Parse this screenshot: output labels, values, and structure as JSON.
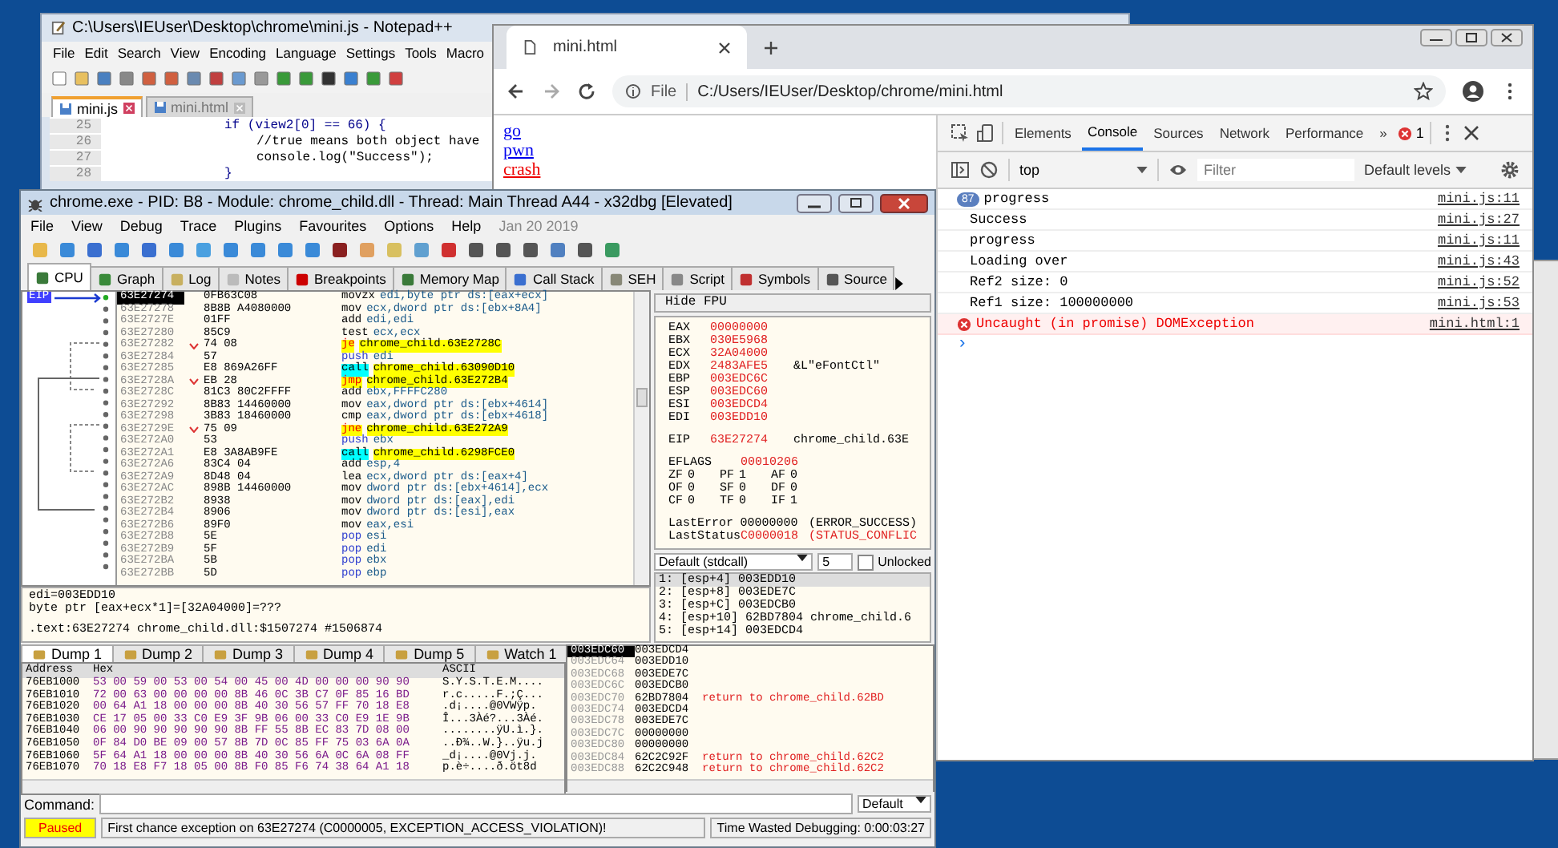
{
  "notepad": {
    "title": "C:\\Users\\IEUser\\Desktop\\chrome\\mini.js - Notepad++",
    "menu": [
      "File",
      "Edit",
      "Search",
      "View",
      "Encoding",
      "Language",
      "Settings",
      "Tools",
      "Macro"
    ],
    "tabs": [
      {
        "label": "mini.js",
        "selected": true
      },
      {
        "label": "mini.html",
        "selected": false
      }
    ],
    "lines": [
      {
        "number": "25",
        "kind": "code",
        "text": "if (view2[0] == 66) {"
      },
      {
        "number": "26",
        "kind": "comment",
        "text": "//true means both object have"
      },
      {
        "number": "27",
        "kind": "code",
        "text": "console.log(\"Success\");"
      },
      {
        "number": "28",
        "kind": "code",
        "text": "}"
      }
    ]
  },
  "chrome": {
    "tab": "mini.html",
    "url_scheme": "File",
    "url": "C:/Users/IEUser/Desktop/chrome/mini.html",
    "links": [
      {
        "text": "go",
        "kind": "normal"
      },
      {
        "text": "pwn",
        "kind": "normal"
      },
      {
        "text": "crash",
        "kind": "danger"
      }
    ],
    "devtools": {
      "tabs": [
        {
          "label": "Elements",
          "selected": false
        },
        {
          "label": "Console",
          "selected": true
        },
        {
          "label": "Sources",
          "selected": false
        },
        {
          "label": "Network",
          "selected": false
        },
        {
          "label": "Performance",
          "selected": false
        }
      ],
      "more": "»",
      "error_count": "1",
      "context": "top",
      "filter_placeholder": "Filter",
      "levels": "Default levels",
      "messages": [
        {
          "kind": "log",
          "count": "87",
          "text": "progress",
          "source": "mini.js:11"
        },
        {
          "kind": "log",
          "text": "Success",
          "source": "mini.js:27"
        },
        {
          "kind": "log",
          "text": "progress",
          "source": "mini.js:11"
        },
        {
          "kind": "log",
          "text": "Loading over",
          "source": "mini.js:43"
        },
        {
          "kind": "log",
          "text": "Ref2 size: 0",
          "source": "mini.js:52"
        },
        {
          "kind": "log",
          "text": "Ref1 size: 100000000",
          "source": "mini.js:53"
        },
        {
          "kind": "error",
          "text": "Uncaught (in promise) DOMException",
          "source": "mini.html:1"
        }
      ],
      "prompt": "›"
    }
  },
  "debugger": {
    "title": "chrome.exe - PID: B8 - Module: chrome_child.dll - Thread: Main Thread A44 - x32dbg [Elevated]",
    "menu": [
      "File",
      "View",
      "Debug",
      "Trace",
      "Plugins",
      "Favourites",
      "Options",
      "Help"
    ],
    "date": "Jan 20 2019",
    "tabs": [
      {
        "label": "CPU",
        "selected": true
      },
      {
        "label": "Graph",
        "selected": false
      },
      {
        "label": "Log",
        "selected": false
      },
      {
        "label": "Notes",
        "selected": false
      },
      {
        "label": "Breakpoints",
        "selected": false
      },
      {
        "label": "Memory Map",
        "selected": false
      },
      {
        "label": "Call Stack",
        "selected": false
      },
      {
        "label": "SEH",
        "selected": false
      },
      {
        "label": "Script",
        "selected": false
      },
      {
        "label": "Symbols",
        "selected": false
      },
      {
        "label": "Source",
        "selected": false
      }
    ],
    "eip_label": "EIP",
    "disasm": [
      {
        "addr": "63E27274",
        "bytes": "0FB63C08",
        "branch": false,
        "kind": "plain",
        "mnemonic": "movzx",
        "operands": "edi,byte ptr ds:[eax+ecx]",
        "selected": true
      },
      {
        "addr": "63E27278",
        "bytes": "8B8B A4080000",
        "branch": false,
        "kind": "plain",
        "mnemonic": "mov",
        "operands": "ecx,dword ptr ds:[ebx+8A4]",
        "selected": false
      },
      {
        "addr": "63E2727E",
        "bytes": "01FF",
        "branch": false,
        "kind": "plain",
        "mnemonic": "add",
        "operands": "edi,edi",
        "selected": false
      },
      {
        "addr": "63E27280",
        "bytes": "85C9",
        "branch": false,
        "kind": "plain",
        "mnemonic": "test",
        "operands": "ecx,ecx",
        "selected": false
      },
      {
        "addr": "63E27282",
        "bytes": "74 08",
        "branch": true,
        "kind": "jump",
        "mnemonic": "je",
        "operands": "chrome_child.63E2728C",
        "selected": false
      },
      {
        "addr": "63E27284",
        "bytes": "57",
        "branch": false,
        "kind": "stack",
        "mnemonic": "push",
        "operands": "edi",
        "selected": false
      },
      {
        "addr": "63E27285",
        "bytes": "E8 869A26FF",
        "branch": false,
        "kind": "call",
        "mnemonic": "call",
        "operands": "chrome_child.63090D10",
        "selected": false
      },
      {
        "addr": "63E2728A",
        "bytes": "EB 28",
        "branch": true,
        "kind": "jump",
        "mnemonic": "jmp",
        "operands": "chrome_child.63E272B4",
        "selected": false
      },
      {
        "addr": "63E2728C",
        "bytes": "81C3 80C2FFFF",
        "branch": false,
        "kind": "plain",
        "mnemonic": "add",
        "operands": "ebx,FFFFC280",
        "selected": false
      },
      {
        "addr": "63E27292",
        "bytes": "8B83 14460000",
        "branch": false,
        "kind": "plain",
        "mnemonic": "mov",
        "operands": "eax,dword ptr ds:[ebx+4614]",
        "selected": false
      },
      {
        "addr": "63E27298",
        "bytes": "3B83 18460000",
        "branch": false,
        "kind": "plain",
        "mnemonic": "cmp",
        "operands": "eax,dword ptr ds:[ebx+4618]",
        "selected": false
      },
      {
        "addr": "63E2729E",
        "bytes": "75 09",
        "branch": true,
        "kind": "jump",
        "mnemonic": "jne",
        "operands": "chrome_child.63E272A9",
        "selected": false
      },
      {
        "addr": "63E272A0",
        "bytes": "53",
        "branch": false,
        "kind": "stack",
        "mnemonic": "push",
        "operands": "ebx",
        "selected": false
      },
      {
        "addr": "63E272A1",
        "bytes": "E8 3A8AB9FE",
        "branch": false,
        "kind": "call",
        "mnemonic": "call",
        "operands": "chrome_child.6298FCE0",
        "selected": false
      },
      {
        "addr": "63E272A6",
        "bytes": "83C4 04",
        "branch": false,
        "kind": "plain",
        "mnemonic": "add",
        "operands": "esp,4",
        "selected": false
      },
      {
        "addr": "63E272A9",
        "bytes": "8D48 04",
        "branch": false,
        "kind": "plain",
        "mnemonic": "lea",
        "operands": "ecx,dword ptr ds:[eax+4]",
        "selected": false
      },
      {
        "addr": "63E272AC",
        "bytes": "898B 14460000",
        "branch": false,
        "kind": "plain",
        "mnemonic": "mov",
        "operands": "dword ptr ds:[ebx+4614],ecx",
        "selected": false
      },
      {
        "addr": "63E272B2",
        "bytes": "8938",
        "branch": false,
        "kind": "plain",
        "mnemonic": "mov",
        "operands": "dword ptr ds:[eax],edi",
        "selected": false
      },
      {
        "addr": "63E272B4",
        "bytes": "8906",
        "branch": false,
        "kind": "plain",
        "mnemonic": "mov",
        "operands": "dword ptr ds:[esi],eax",
        "selected": false
      },
      {
        "addr": "63E272B6",
        "bytes": "89F0",
        "branch": false,
        "kind": "plain",
        "mnemonic": "mov",
        "operands": "eax,esi",
        "selected": false
      },
      {
        "addr": "63E272B8",
        "bytes": "5E",
        "branch": false,
        "kind": "stack",
        "mnemonic": "pop",
        "operands": "esi",
        "selected": false
      },
      {
        "addr": "63E272B9",
        "bytes": "5F",
        "branch": false,
        "kind": "stack",
        "mnemonic": "pop",
        "operands": "edi",
        "selected": false
      },
      {
        "addr": "63E272BA",
        "bytes": "5B",
        "branch": false,
        "kind": "stack",
        "mnemonic": "pop",
        "operands": "ebx",
        "selected": false
      },
      {
        "addr": "63E272BB",
        "bytes": "5D",
        "branch": false,
        "kind": "stack",
        "mnemonic": "pop",
        "operands": "ebp",
        "selected": false
      }
    ],
    "fpu_button": "Hide FPU",
    "registers": [
      {
        "name": "EAX",
        "value": "00000000"
      },
      {
        "name": "EBX",
        "value": "030E5968"
      },
      {
        "name": "ECX",
        "value": "32A04000"
      },
      {
        "name": "EDX",
        "value": "2483AFE5",
        "comment": "&L\"eFontCtl\""
      },
      {
        "name": "EBP",
        "value": "003EDC6C"
      },
      {
        "name": "ESP",
        "value": "003EDC60"
      },
      {
        "name": "ESI",
        "value": "003EDCD4"
      },
      {
        "name": "EDI",
        "value": "003EDD10"
      }
    ],
    "eip": {
      "name": "EIP",
      "value": "63E27274",
      "comment": "chrome_child.63E"
    },
    "eflags": {
      "name": "EFLAGS",
      "value": "00010206"
    },
    "flags": [
      [
        "ZF",
        "0",
        "PF",
        "1",
        "AF",
        "0"
      ],
      [
        "OF",
        "0",
        "SF",
        "0",
        "DF",
        "0"
      ],
      [
        "CF",
        "0",
        "TF",
        "0",
        "IF",
        "1"
      ]
    ],
    "last": [
      {
        "name": "LastError",
        "value": "00000000",
        "comment": "(ERROR_SUCCESS)"
      },
      {
        "name": "LastStatus",
        "value": "C0000018",
        "comment": "(STATUS_CONFLIC"
      }
    ],
    "callconv": "Default (stdcall)",
    "arg_count": "5",
    "unlocked": {
      "label": "Unlocked",
      "checked": false
    },
    "args": [
      "1: [esp+4] 003EDD10",
      "2: [esp+8] 003EDE7C",
      "3: [esp+C] 003EDCB0",
      "4: [esp+10] 62BD7804 chrome_child.6",
      "5: [esp+14] 003EDCD4"
    ],
    "info": [
      "edi=003EDD10",
      "byte ptr [eax+ecx*1]=[32A04000]=???",
      ".text:63E27274 chrome_child.dll:$1507274 #1506874"
    ],
    "dump_tabs": [
      {
        "label": "Dump 1",
        "selected": true
      },
      {
        "label": "Dump 2",
        "selected": false
      },
      {
        "label": "Dump 3",
        "selected": false
      },
      {
        "label": "Dump 4",
        "selected": false
      },
      {
        "label": "Dump 5",
        "selected": false
      },
      {
        "label": "Watch 1",
        "selected": false
      }
    ],
    "dump_columns": [
      "Address",
      "Hex",
      "ASCII"
    ],
    "dump": [
      {
        "addr": "76EB1000",
        "hex": "53 00 59 00 53 00 54 00 45 00 4D 00 00 00 90 90",
        "ascii": "S.Y.S.T.E.M...."
      },
      {
        "addr": "76EB1010",
        "hex": "72 00 63 00 00 00 00 8B 46 0C 3B C7 0F 85 16 BD",
        "ascii": "r.c.....F.;Ç..."
      },
      {
        "addr": "76EB1020",
        "hex": "00 64 A1 18 00 00 00 8B 40 30 56 57 FF 70 18 E8",
        "ascii": ".d¡....@0VWÿp."
      },
      {
        "addr": "76EB1030",
        "hex": "CE 17 05 00 33 C0 E9 3F 9B 06 00 33 C0 E9 1E 9B",
        "ascii": "Î...3Àé?...3Àé."
      },
      {
        "addr": "76EB1040",
        "hex": "06 00 90 90 90 90 90 8B FF 55 8B EC 83 7D 08 00",
        "ascii": "........ÿU.ì.}."
      },
      {
        "addr": "76EB1050",
        "hex": "0F 84 D0 BE 09 00 57 8B 7D 0C 85 FF 75 03 6A 0A",
        "ascii": "..Ð¾..W.}..ÿu.j"
      },
      {
        "addr": "76EB1060",
        "hex": "5F 64 A1 18 00 00 00 8B 40 30 56 6A 0C 6A 08 FF",
        "ascii": "_d¡....@0Vj.j."
      },
      {
        "addr": "76EB1070",
        "hex": "70 18 E8 F7 18 05 00 8B F0 85 F6 74 38 64 A1 18",
        "ascii": "p.è÷....ð.öt8d"
      }
    ],
    "stack": [
      {
        "addr": "003EDC60",
        "value": "003EDCD4",
        "selected": true
      },
      {
        "addr": "003EDC64",
        "value": "003EDD10",
        "selected": false
      },
      {
        "addr": "003EDC68",
        "value": "003EDE7C",
        "selected": false
      },
      {
        "addr": "003EDC6C",
        "value": "003EDCB0",
        "selected": false
      },
      {
        "addr": "003EDC70",
        "value": "62BD7804",
        "comment": "return to chrome_child.62BD",
        "selected": false
      },
      {
        "addr": "003EDC74",
        "value": "003EDCD4",
        "selected": false
      },
      {
        "addr": "003EDC78",
        "value": "003EDE7C",
        "selected": false
      },
      {
        "addr": "003EDC7C",
        "value": "00000000",
        "selected": false
      },
      {
        "addr": "003EDC80",
        "value": "00000000",
        "selected": false
      },
      {
        "addr": "003EDC84",
        "value": "62C2C92F",
        "comment": "return to chrome_child.62C2",
        "selected": false
      },
      {
        "addr": "003EDC88",
        "value": "62C2C948",
        "comment": "return to chrome_child.62C2",
        "selected": false
      }
    ],
    "command_label": "Command:",
    "command_mode": "Default",
    "status": "Paused",
    "message": "First chance exception on 63E27274 (C0000005, EXCEPTION_ACCESS_VIOLATION)!",
    "time": "Time Wasted Debugging: 0:00:03:27"
  }
}
